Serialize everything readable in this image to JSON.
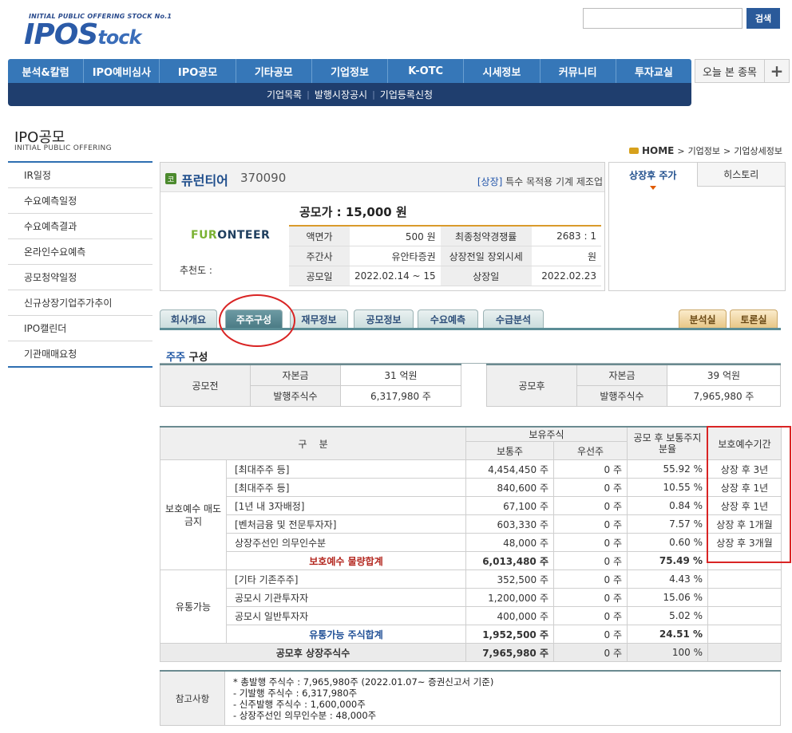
{
  "header": {
    "logo_tagline": "INITIAL PUBLIC OFFERING STOCK No.1",
    "logo_main": "IPOS",
    "logo_tail": "tock",
    "search_placeholder": "",
    "search_button": "검색"
  },
  "main_nav": [
    "분석&칼럼",
    "IPO예비심사",
    "IPO공모",
    "기타공모",
    "기업정보",
    "K-OTC",
    "시세정보",
    "커뮤니티",
    "투자교실"
  ],
  "today_tab": "오늘 본 종목",
  "plus_label": "+",
  "sub_nav": [
    "기업목록",
    "발행시장공시",
    "기업등록신청"
  ],
  "section": {
    "title": "IPO공모",
    "subtitle": "INITIAL PUBLIC OFFERING"
  },
  "left_menu": [
    "IR일정",
    "수요예측일정",
    "수요예측결과",
    "온라인수요예측",
    "공모청약일정",
    "신규상장기업주가추이",
    "IPO캘린더",
    "기관매매요청"
  ],
  "breadcrumb": {
    "home": "HOME",
    "items": [
      "기업정보",
      "기업상세정보"
    ]
  },
  "company": {
    "badge": "코",
    "name": "퓨런티어",
    "code": "370090",
    "listing_tag": "[상장]",
    "industry": "특수 목적용 기계 제조업",
    "logo_text_a": "FUR",
    "logo_text_b": "O",
    "logo_text_c": "NTEER",
    "recommend_label": "추천도 :",
    "offer_price": "공모가 : 15,000 원",
    "info": {
      "face_value_label": "액면가",
      "face_value": "500 원",
      "competition_label": "최종청약경쟁률",
      "competition": "2683 : 1",
      "underwriter_label": "주간사",
      "underwriter": "유안타증권",
      "otc_label": "상장전일 장외시세",
      "otc": "원",
      "offer_date_label": "공모일",
      "offer_date": "2022.02.14 ~ 15",
      "listing_date_label": "상장일",
      "listing_date": "2022.02.23"
    }
  },
  "side_panel": {
    "tab_active": "상장후 주가",
    "tab_other": "히스토리"
  },
  "tabs": [
    "회사개요",
    "주주구성",
    "재무정보",
    "공모정보",
    "수요예측",
    "수급분석"
  ],
  "right_tabs": [
    "분석실",
    "토론실"
  ],
  "shareholder_heading": {
    "blue": "주주",
    "rest": " 구성"
  },
  "capital_before": {
    "group": "공모전",
    "capital_label": "자본금",
    "capital": "31 억원",
    "shares_label": "발행주식수",
    "shares": "6,317,980 주"
  },
  "capital_after": {
    "group": "공모후",
    "capital_label": "자본금",
    "capital": "39 억원",
    "shares_label": "발행주식수",
    "shares": "7,965,980 주"
  },
  "main_table": {
    "h_category": "구    분",
    "h_holding": "보유주식",
    "h_common": "보통주",
    "h_preferred": "우선주",
    "h_ratio": "공모 후 보통주지분율",
    "h_lockup": "보호예수기간",
    "group_protected": "보호예수 매도금지",
    "group_tradable": "유통가능",
    "rows": [
      [
        "[최대주주 등]",
        "4,454,450 주",
        "0 주",
        "55.92 %",
        "상장 후 3년"
      ],
      [
        "[최대주주 등]",
        "840,600 주",
        "0 주",
        "10.55 %",
        "상장 후 1년"
      ],
      [
        "[1년 내 3자배정]",
        "67,100 주",
        "0 주",
        "0.84 %",
        "상장 후 1년"
      ],
      [
        "[벤처금융 및 전문투자자]",
        "603,330 주",
        "0 주",
        "7.57 %",
        "상장 후 1개월"
      ],
      [
        "상장주선인 의무인수분",
        "48,000 주",
        "0 주",
        "0.60 %",
        "상장 후 3개월"
      ]
    ],
    "subtotal_protected": [
      "보호예수 물량합계",
      "6,013,480 주",
      "0 주",
      "75.49 %",
      ""
    ],
    "tradable_rows": [
      [
        "[기타 기존주주]",
        "352,500 주",
        "0 주",
        "4.43 %",
        ""
      ],
      [
        "공모시 기관투자자",
        "1,200,000 주",
        "0 주",
        "15.06 %",
        ""
      ],
      [
        "공모시 일반투자자",
        "400,000 주",
        "0 주",
        "5.02 %",
        ""
      ]
    ],
    "subtotal_tradable": [
      "유통가능 주식합계",
      "1,952,500 주",
      "0 주",
      "24.51 %",
      ""
    ],
    "total": [
      "공모후 상장주식수",
      "7,965,980 주",
      "0 주",
      "100 %",
      ""
    ]
  },
  "notes": {
    "label": "참고사항",
    "lines": [
      "* 총발행 주식수 : 7,965,980주 (2022.01.07~ 증권신고서 기준)",
      "- 기발행 주식수 : 6,317,980주",
      "- 신주발행 주식수 : 1,600,000주",
      "- 상장주선인 의무인수분 : 48,000주"
    ]
  }
}
